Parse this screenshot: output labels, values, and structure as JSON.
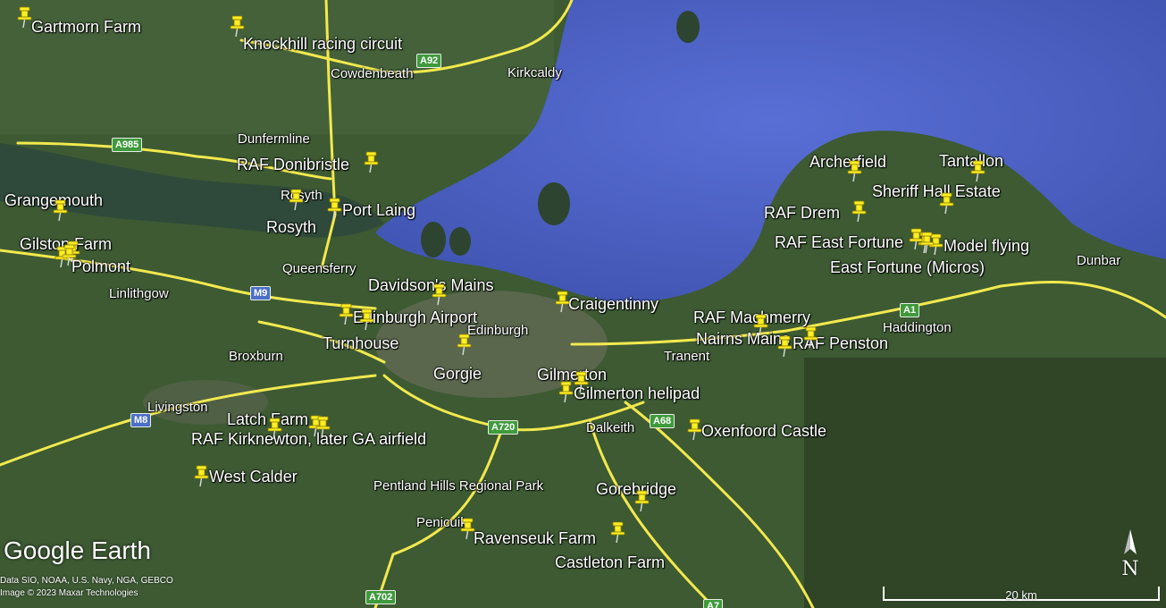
{
  "brand": "Google Earth",
  "credits": [
    "Data SIO, NOAA, U.S. Navy, NGA, GEBCO",
    "Image © 2023 Maxar Technologies"
  ],
  "scale_label": "20 km",
  "compass_label": "N",
  "colors": {
    "land": "#3d5a33",
    "sea": "#4f63c7",
    "road": "#f2e94e",
    "pin": "#ffee22"
  },
  "places": [
    "Gartmorn Farm",
    "Knockhill racing circuit",
    "RAF Donibristle",
    "Grangemouth",
    "Port Laing",
    "Rosyth",
    "Gilston Farm",
    "Polmont",
    "Davidson's Mains",
    "Edinburgh Airport",
    "Turnhouse",
    "Craigentinny",
    "Gorgie",
    "Gilmerton",
    "Gilmerton helipad",
    "Latch Farm",
    "RAF Kirknewton, later GA airfield",
    "West Calder",
    "Oxenfoord Castle",
    "Gorebridge",
    "Ravenseuk Farm",
    "Castleton Farm",
    "Archerfield",
    "Tantallon",
    "Sheriff Hall Estate",
    "RAF Drem",
    "RAF East Fortune",
    "Model flying",
    "East Fortune (Micros)",
    "RAF Machmerry",
    "Nairns Mains",
    "RAF Penston"
  ],
  "towns": [
    "Cowdenbeath",
    "Kirkcaldy",
    "Dunfermline",
    "Rosyth",
    "Queensferry",
    "Linlithgow",
    "Broxburn",
    "Livingston",
    "Edinburgh",
    "Tranent",
    "Haddington",
    "Dalkeith",
    "Pentland Hills Regional Park",
    "Penicuik",
    "Dunbar"
  ],
  "roads": [
    "A92",
    "A985",
    "M9",
    "M8",
    "A720",
    "A68",
    "A1",
    "A702",
    "A7"
  ]
}
